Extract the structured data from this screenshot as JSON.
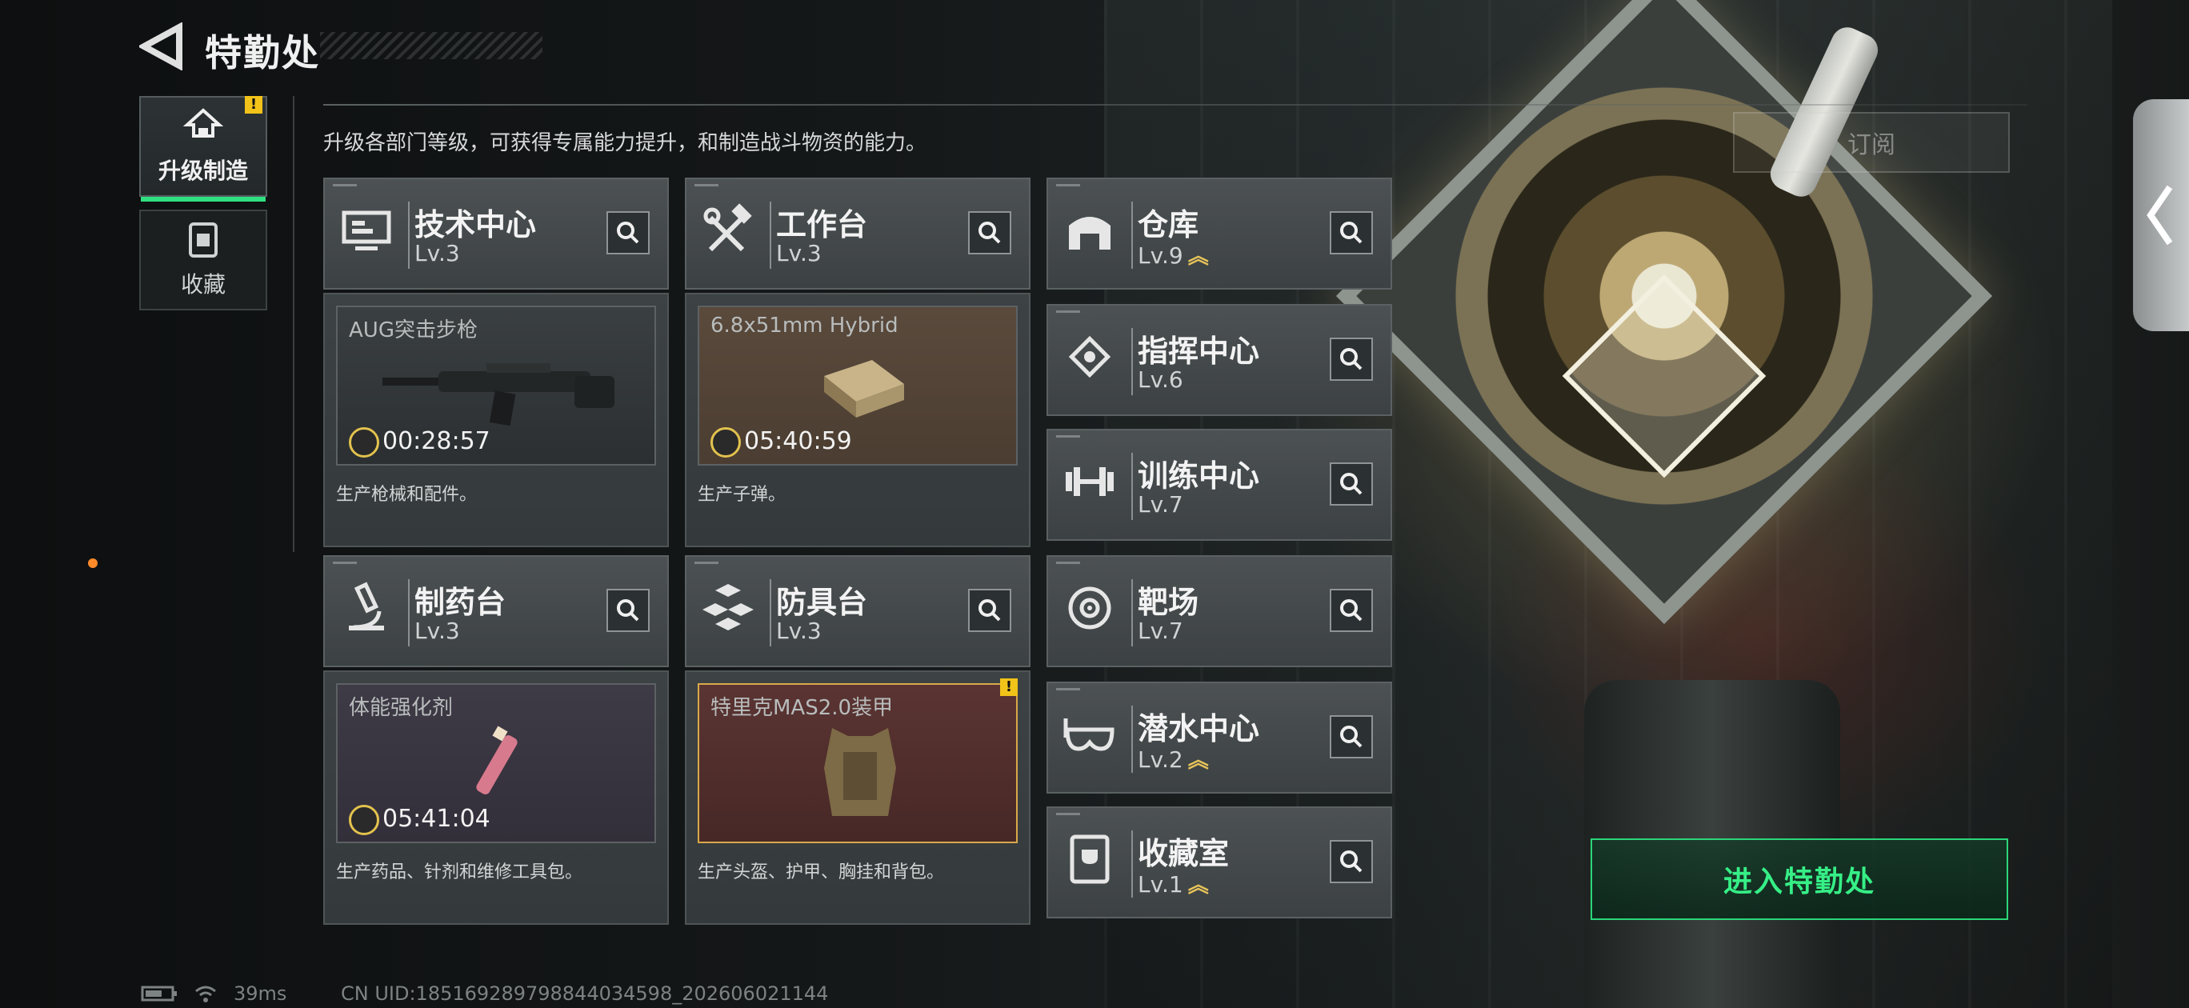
{
  "header": {
    "title": "特勤处"
  },
  "side_nav": [
    {
      "label": "升级制造",
      "active": true,
      "warning": "!"
    },
    {
      "label": "收藏",
      "active": false
    }
  ],
  "description": "升级各部门等级，可获得专属能力提升，和制造战斗物资的能力。",
  "workstations": [
    {
      "name": "技术中心",
      "level": "Lv.3",
      "icon": "monitor-icon",
      "production": {
        "item": "AUG突击步枪",
        "time": "00:28:57",
        "desc": "生产枪械和配件。",
        "bg": "gray"
      }
    },
    {
      "name": "工作台",
      "level": "Lv.3",
      "icon": "tools-icon",
      "production": {
        "item": "6.8x51mm Hybrid",
        "time": "05:40:59",
        "desc": "生产子弹。",
        "bg": "brown"
      }
    },
    {
      "name": "制药台",
      "level": "Lv.3",
      "icon": "microscope-icon",
      "production": {
        "item": "体能强化剂",
        "time": "05:41:04",
        "desc": "生产药品、针剂和维修工具包。",
        "bg": "purple"
      }
    },
    {
      "name": "防具台",
      "level": "Lv.3",
      "icon": "cubes-icon",
      "production": {
        "item": "特里克MAS2.0装甲",
        "time": "",
        "desc": "生产头盔、护甲、胸挂和背包。",
        "bg": "red",
        "warning": "!"
      }
    }
  ],
  "facilities": [
    {
      "name": "仓库",
      "level": "Lv.9",
      "upgradable": true,
      "icon": "warehouse-icon"
    },
    {
      "name": "指挥中心",
      "level": "Lv.6",
      "upgradable": false,
      "icon": "command-icon"
    },
    {
      "name": "训练中心",
      "level": "Lv.7",
      "upgradable": false,
      "icon": "dumbbell-icon"
    },
    {
      "name": "靶场",
      "level": "Lv.7",
      "upgradable": false,
      "icon": "target-icon"
    },
    {
      "name": "潜水中心",
      "level": "Lv.2",
      "upgradable": true,
      "icon": "diving-mask-icon"
    },
    {
      "name": "收藏室",
      "level": "Lv.1",
      "upgradable": true,
      "icon": "trophy-icon"
    }
  ],
  "upgrade_glyph": "︽",
  "enter_button": "进入特勤处",
  "subscribe_button": "订阅",
  "footer": {
    "ping": "39ms",
    "uid": "CN UID:18516928979884403459​8_202606021144"
  },
  "colors": {
    "accent_green": "#36ef86",
    "upgrade_gold": "#e8c45a",
    "warning": "#f2c318"
  }
}
